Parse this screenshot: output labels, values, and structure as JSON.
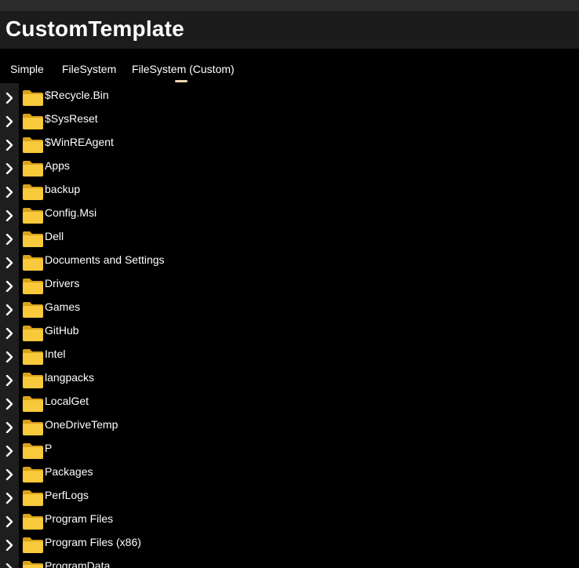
{
  "app": {
    "title": "CustomTemplate"
  },
  "tabs": [
    {
      "label": "Simple"
    },
    {
      "label": "FileSystem"
    },
    {
      "label": "FileSystem (Custom)",
      "selected": true
    }
  ],
  "colors": {
    "accent": "#e8d7b0",
    "folder_front": "#f8c93a",
    "folder_back": "#d9a21b",
    "chevron_bg": "#1e1e1e"
  },
  "tree": {
    "items": [
      {
        "label": "$Recycle.Bin",
        "icon": "folder-icon"
      },
      {
        "label": "$SysReset",
        "icon": "folder-icon"
      },
      {
        "label": "$WinREAgent",
        "icon": "folder-icon"
      },
      {
        "label": "Apps",
        "icon": "folder-icon"
      },
      {
        "label": "backup",
        "icon": "folder-icon"
      },
      {
        "label": "Config.Msi",
        "icon": "folder-icon"
      },
      {
        "label": "Dell",
        "icon": "folder-icon"
      },
      {
        "label": "Documents and Settings",
        "icon": "folder-icon"
      },
      {
        "label": "Drivers",
        "icon": "folder-icon"
      },
      {
        "label": "Games",
        "icon": "folder-icon"
      },
      {
        "label": "GitHub",
        "icon": "folder-icon"
      },
      {
        "label": "Intel",
        "icon": "folder-icon"
      },
      {
        "label": "langpacks",
        "icon": "folder-icon"
      },
      {
        "label": "LocalGet",
        "icon": "folder-icon"
      },
      {
        "label": "OneDriveTemp",
        "icon": "folder-icon"
      },
      {
        "label": "P",
        "icon": "folder-icon"
      },
      {
        "label": "Packages",
        "icon": "folder-icon"
      },
      {
        "label": "PerfLogs",
        "icon": "folder-icon"
      },
      {
        "label": "Program Files",
        "icon": "folder-icon"
      },
      {
        "label": "Program Files (x86)",
        "icon": "folder-icon"
      },
      {
        "label": "ProgramData",
        "icon": "folder-icon"
      }
    ]
  }
}
